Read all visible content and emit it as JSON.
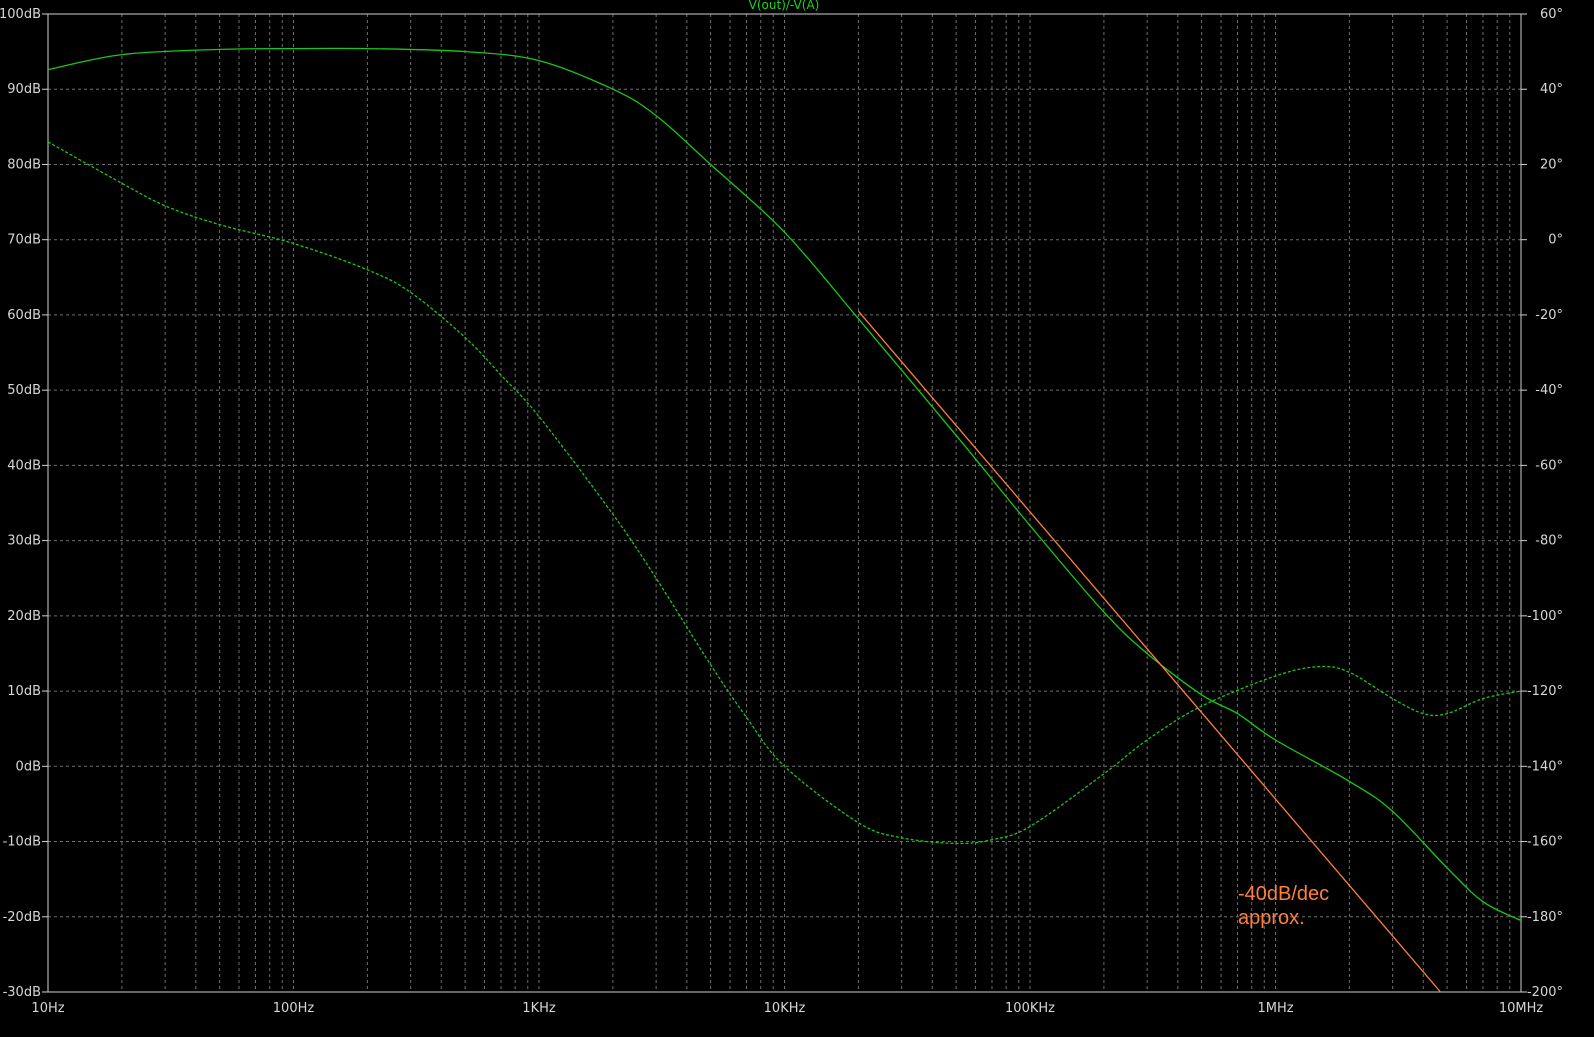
{
  "colors": {
    "background": "#000000",
    "grid": "#6e6e6e",
    "frame": "#d0d0d0",
    "tick_text": "#d6d6d6",
    "magnitude": "#18c818",
    "phase": "#18c818",
    "asymptote": "#ff7f3f",
    "title": "#16d816"
  },
  "chart_data": {
    "type": "line",
    "title": "V(out)/-V(A)",
    "x_scale": "log",
    "x_range": [
      10,
      10000000
    ],
    "x_ticks": [
      {
        "value": 10,
        "label": "10Hz"
      },
      {
        "value": 100,
        "label": "100Hz"
      },
      {
        "value": 1000,
        "label": "1KHz"
      },
      {
        "value": 10000,
        "label": "10KHz"
      },
      {
        "value": 100000,
        "label": "100KHz"
      },
      {
        "value": 1000000,
        "label": "1MHz"
      },
      {
        "value": 10000000,
        "label": "10MHz"
      }
    ],
    "y_left": {
      "range": [
        -30,
        100
      ],
      "ticks": [
        {
          "value": 100,
          "label": "100dB"
        },
        {
          "value": 90,
          "label": "90dB"
        },
        {
          "value": 80,
          "label": "80dB"
        },
        {
          "value": 70,
          "label": "70dB"
        },
        {
          "value": 60,
          "label": "60dB"
        },
        {
          "value": 50,
          "label": "50dB"
        },
        {
          "value": 40,
          "label": "40dB"
        },
        {
          "value": 30,
          "label": "30dB"
        },
        {
          "value": 20,
          "label": "20dB"
        },
        {
          "value": 10,
          "label": "10dB"
        },
        {
          "value": 0,
          "label": "0dB"
        },
        {
          "value": -10,
          "label": "-10dB"
        },
        {
          "value": -20,
          "label": "-20dB"
        },
        {
          "value": -30,
          "label": "-30dB"
        }
      ]
    },
    "y_right": {
      "range": [
        -200,
        60
      ],
      "ticks": [
        {
          "value": 60,
          "label": "60°"
        },
        {
          "value": 40,
          "label": "40°"
        },
        {
          "value": 20,
          "label": "20°"
        },
        {
          "value": 0,
          "label": "0°"
        },
        {
          "value": -20,
          "label": "-20°"
        },
        {
          "value": -40,
          "label": "-40°"
        },
        {
          "value": -60,
          "label": "-60°"
        },
        {
          "value": -80,
          "label": "-80°"
        },
        {
          "value": -100,
          "label": "-100°"
        },
        {
          "value": -120,
          "label": "-120°"
        },
        {
          "value": -140,
          "label": "-140°"
        },
        {
          "value": -160,
          "label": "-160°"
        },
        {
          "value": -180,
          "label": "-180°"
        },
        {
          "value": -200,
          "label": "-200°"
        }
      ]
    },
    "grid": true,
    "series": [
      {
        "style": "solid",
        "axis": "left",
        "points": [
          [
            10,
            92.6
          ],
          [
            20,
            94.6
          ],
          [
            50,
            95.3
          ],
          [
            100,
            95.4
          ],
          [
            200,
            95.4
          ],
          [
            500,
            95.0
          ],
          [
            1000,
            93.8
          ],
          [
            2000,
            90.0
          ],
          [
            3000,
            86.5
          ],
          [
            5000,
            80.0
          ],
          [
            10000,
            71.0
          ],
          [
            20000,
            59.5
          ],
          [
            50000,
            44.0
          ],
          [
            100000,
            32.0
          ],
          [
            200000,
            20.5
          ],
          [
            300000,
            15.0
          ],
          [
            500000,
            9.5
          ],
          [
            700000,
            7.0
          ],
          [
            1000000,
            3.5
          ],
          [
            2000000,
            -2.0
          ],
          [
            3000000,
            -6.0
          ],
          [
            5000000,
            -13.5
          ],
          [
            7000000,
            -18.0
          ],
          [
            10000000,
            -20.5
          ]
        ]
      },
      {
        "style": "dashed",
        "axis": "right",
        "points": [
          [
            10,
            26
          ],
          [
            20,
            15
          ],
          [
            30,
            9
          ],
          [
            50,
            4
          ],
          [
            100,
            -1
          ],
          [
            200,
            -8
          ],
          [
            300,
            -14
          ],
          [
            500,
            -26
          ],
          [
            700,
            -36
          ],
          [
            1000,
            -47
          ],
          [
            2000,
            -73
          ],
          [
            3000,
            -90
          ],
          [
            5000,
            -113
          ],
          [
            7000,
            -127
          ],
          [
            10000,
            -140
          ],
          [
            20000,
            -155
          ],
          [
            30000,
            -159
          ],
          [
            50000,
            -160.5
          ],
          [
            70000,
            -159.5
          ],
          [
            100000,
            -156
          ],
          [
            200000,
            -142
          ],
          [
            300000,
            -133
          ],
          [
            500000,
            -124
          ],
          [
            1000000,
            -116
          ],
          [
            1500000,
            -113.5
          ],
          [
            2000000,
            -115
          ],
          [
            3000000,
            -122
          ],
          [
            4000000,
            -126
          ],
          [
            5000000,
            -126
          ],
          [
            7000000,
            -122
          ],
          [
            10000000,
            -120
          ]
        ]
      },
      {
        "style": "solid",
        "axis": "left",
        "points": [
          [
            20000,
            60.5
          ],
          [
            4700000,
            -30
          ]
        ]
      }
    ],
    "annotations": [
      "-40dB/dec",
      "approx."
    ]
  }
}
